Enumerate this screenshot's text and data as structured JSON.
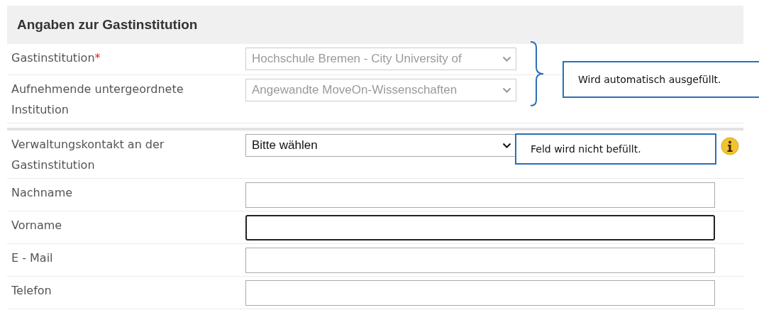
{
  "section": {
    "title": "Angaben zur Gastinstitution"
  },
  "groups": [
    {
      "rows": [
        {
          "label": "Gastinstitution",
          "required_mark": "*",
          "kind": "select",
          "value": "Hochschule Bremen - City University of",
          "disabled": true
        },
        {
          "label": "Aufnehmende untergeordnete Institution",
          "kind": "select",
          "value": "Angewandte MoveOn-Wissenschaften",
          "disabled": true
        }
      ]
    },
    {
      "rows": [
        {
          "label": "Verwaltungskontakt an der Gastinstitution",
          "kind": "select",
          "value": "Bitte wählen",
          "disabled": false,
          "info": true
        },
        {
          "label": "Nachname",
          "kind": "text",
          "focused": false
        },
        {
          "label": "Vorname",
          "kind": "text",
          "focused": true
        },
        {
          "label": "E - Mail",
          "kind": "text",
          "focused": false
        },
        {
          "label": "Telefon",
          "kind": "text",
          "focused": false
        }
      ]
    }
  ],
  "callouts": [
    {
      "text": "Wird automatisch ausgefüllt.",
      "brace": true
    },
    {
      "text": "Feld wird nicht befüllt.",
      "brace": false
    }
  ]
}
